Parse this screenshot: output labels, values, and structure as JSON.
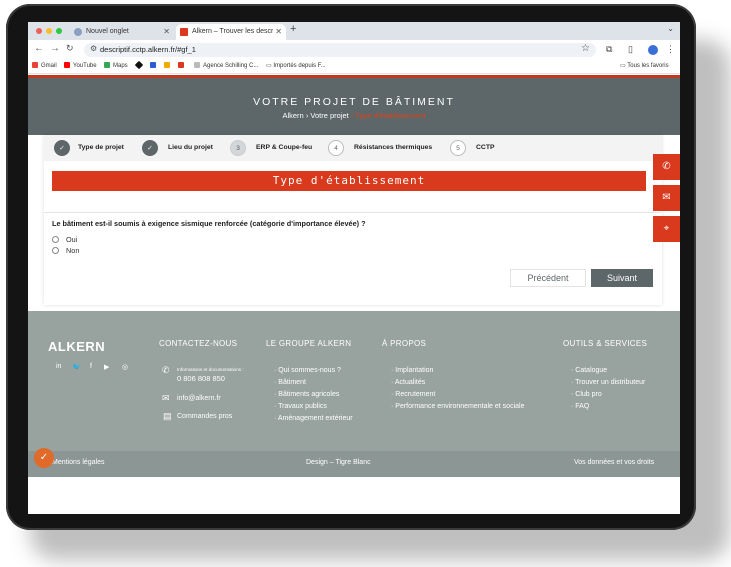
{
  "browser": {
    "tabs": [
      {
        "title": "Nouvel onglet",
        "active": false
      },
      {
        "title": "Alkern – Trouver les descripti",
        "active": true
      }
    ],
    "url": "descriptif.cctp.alkern.fr/#gf_1",
    "bookmarks": [
      "Gmail",
      "YouTube",
      "Maps",
      "Agence Schilling C...",
      "Importés depuis F...",
      "Tous les favoris"
    ],
    "colors": {
      "tabbar": "#dee3ea",
      "profile": "#3a6fd8"
    }
  },
  "header": {
    "title": "VOTRE PROJET DE BÂTIMENT",
    "breadcrumb": {
      "home": "Alkern",
      "sep": " › ",
      "parent": "Votre projet",
      "current": "› Type d'établissement"
    }
  },
  "steps": [
    {
      "number": "✓",
      "label": "Type de projet",
      "state": "done"
    },
    {
      "number": "✓",
      "label": "Lieu du projet",
      "state": "done"
    },
    {
      "number": "3",
      "label": "ERP & Coupe-feu",
      "state": "current"
    },
    {
      "number": "4",
      "label": "Résistances thermiques",
      "state": "todo"
    },
    {
      "number": "5",
      "label": "CCTP",
      "state": "todo"
    }
  ],
  "form": {
    "section_title": "Type d'établissement",
    "question": "Le bâtiment est-il soumis à exigence sismique renforcée (catégorie d'importance élevée) ?",
    "options": [
      "Oui",
      "Non"
    ],
    "prev_label": "Précédent",
    "next_label": "Suivant"
  },
  "side_buttons": [
    "phone-icon",
    "mail-icon",
    "location-icon"
  ],
  "footer": {
    "logo": "ALKERN",
    "social": [
      "linkedin-icon",
      "twitter-icon",
      "facebook-icon",
      "youtube-icon",
      "instagram-icon"
    ],
    "contact": {
      "heading": "CONTACTEZ-NOUS",
      "phone_caption": "Informations et documentations :",
      "phone": "0 806 808 850",
      "email": "info@alkern.fr",
      "orders": "Commandes pros"
    },
    "groupe": {
      "heading": "LE GROUPE ALKERN",
      "items": [
        "Qui sommes-nous ?",
        "Bâtiment",
        "Bâtiments agricoles",
        "Travaux publics",
        "Aménagement extérieur"
      ]
    },
    "apropos": {
      "heading": "À PROPOS",
      "items": [
        "Implantation",
        "Actualités",
        "Recrutement",
        "Performance environnementale et sociale"
      ]
    },
    "outils": {
      "heading": "OUTILS & SERVICES",
      "items": [
        "Catalogue",
        "Trouver un distributeur",
        "Club pro",
        "FAQ"
      ]
    },
    "bottom": {
      "legal": "Mentions légales",
      "design": "Design – Tigre Blanc",
      "data": "Vos données et vos droits"
    }
  },
  "colors": {
    "accent": "#d9391c",
    "hero": "#5d6668",
    "footer": "#98a29f"
  }
}
